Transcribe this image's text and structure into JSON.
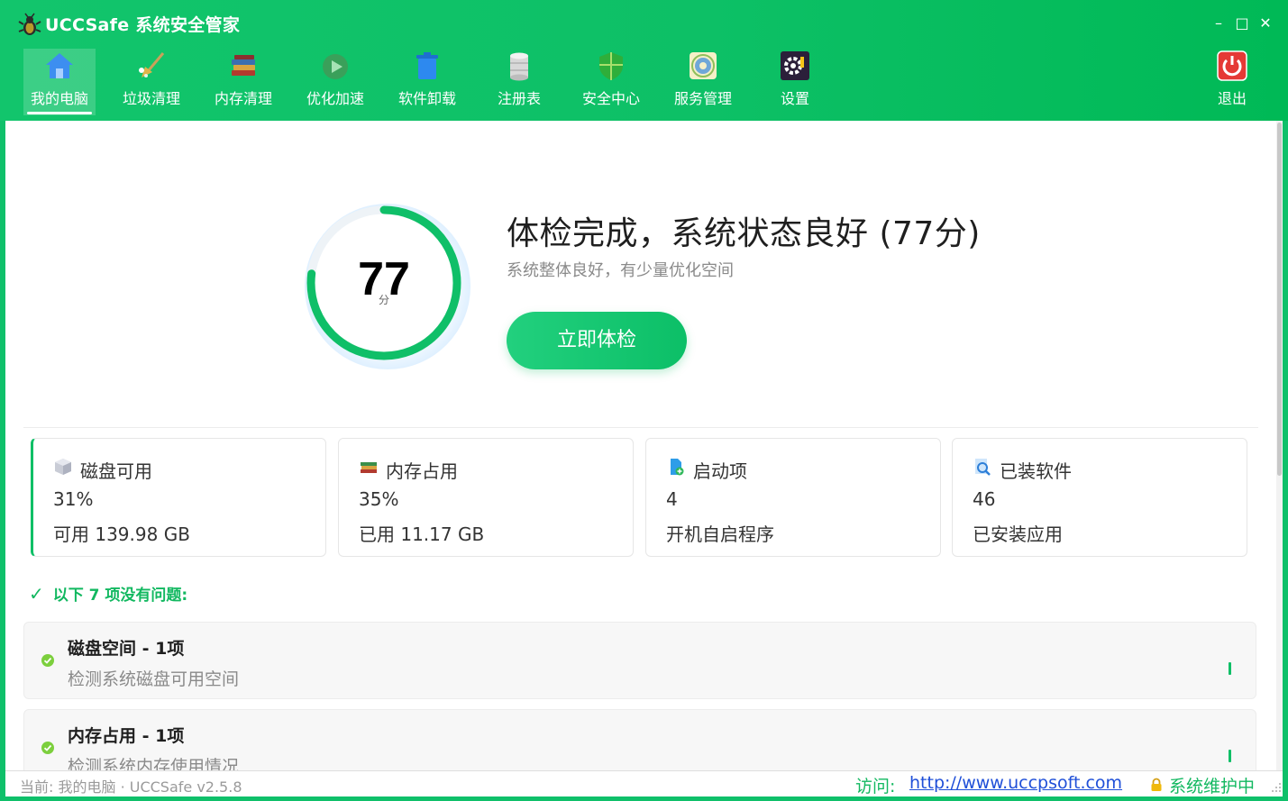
{
  "app": {
    "title": "UCCSafe 系统安全管家",
    "window_controls": {
      "minimize": "–",
      "maximize": "□",
      "close": "✕"
    }
  },
  "nav": {
    "items": [
      {
        "label": "我的电脑",
        "icon": "home-icon",
        "active": true
      },
      {
        "label": "垃圾清理",
        "icon": "broom-icon",
        "active": false
      },
      {
        "label": "内存清理",
        "icon": "books-icon",
        "active": false
      },
      {
        "label": "优化加速",
        "icon": "play-icon",
        "active": false
      },
      {
        "label": "软件卸载",
        "icon": "trash-icon",
        "active": false
      },
      {
        "label": "注册表",
        "icon": "database-icon",
        "active": false
      },
      {
        "label": "安全中心",
        "icon": "shield-icon",
        "active": false
      },
      {
        "label": "服务管理",
        "icon": "services-icon",
        "active": false
      },
      {
        "label": "设置",
        "icon": "gear-icon",
        "active": false
      }
    ],
    "exit": {
      "label": "退出",
      "icon": "power-icon"
    }
  },
  "summary": {
    "score": "77",
    "score_value": 77,
    "score_unit": "分",
    "headline": "体检完成，系统状态良好 (77分)",
    "subline": "系统整体良好，有少量优化空间",
    "button": "立即体检"
  },
  "stats": [
    {
      "title": "磁盘可用",
      "value": "31%",
      "sub": "可用 139.98 GB",
      "icon": "disk-icon"
    },
    {
      "title": "内存占用",
      "value": "35%",
      "sub": "已用 11.17 GB",
      "icon": "memory-books-icon"
    },
    {
      "title": "启动项",
      "value": "4",
      "sub": "开机自启程序",
      "icon": "startup-file-icon"
    },
    {
      "title": "已装软件",
      "value": "46",
      "sub": "已安装应用",
      "icon": "software-search-icon"
    }
  ],
  "checks": {
    "heading_tick": "✓",
    "heading": "以下 7 项没有问题:",
    "items": [
      {
        "title": "磁盘空间 - 1项",
        "desc": "检测系统磁盘可用空间"
      },
      {
        "title": "内存占用 - 1项",
        "desc": "检测系统内存使用情况"
      }
    ]
  },
  "status": {
    "current": "当前: 我的电脑 · UCCSafe v2.5.8",
    "visit_label": "访问:",
    "url": "http://www.uccpsoft.com",
    "maintenance": "系统维护中"
  },
  "colors": {
    "brand_green": "#0dc066",
    "link_blue": "#1f4fd8",
    "exit_red": "#e53935"
  }
}
